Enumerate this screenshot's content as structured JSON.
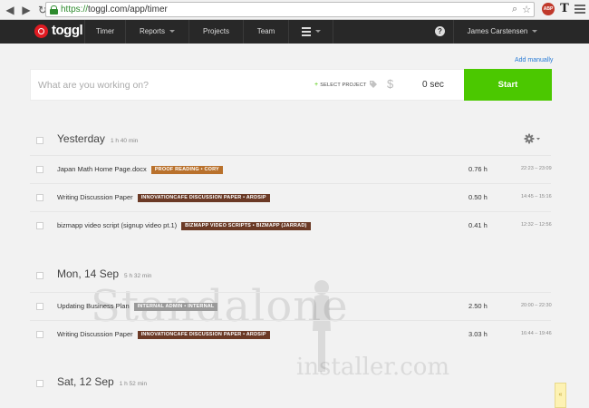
{
  "browser": {
    "url_scheme": "https://",
    "url_rest": "toggl.com/app/timer",
    "ext_abp": "ABP",
    "ext_t": "T"
  },
  "header": {
    "logo": "toggl",
    "nav": [
      "Timer",
      "Reports",
      "Projects",
      "Team"
    ],
    "help": "?",
    "user": "James Carstensen"
  },
  "timer": {
    "add_manually": "Add manually",
    "placeholder": "What are you working on?",
    "select_project": "SELECT PROJECT",
    "duration": "0 sec",
    "start_label": "Start"
  },
  "days": [
    {
      "title": "Yesterday",
      "total": "1 h 40 min",
      "entries": [
        {
          "description": "Japan Math Home Page.docx",
          "tag": "PROOF READING  •  CORY",
          "tag_color": "#b9712c",
          "duration": "0.76 h",
          "range": "22:23 – 23:09"
        },
        {
          "description": "Writing Discussion Paper",
          "tag": "INNOVATIONCAFE DISCUSSION PAPER  •  ARDSIP",
          "tag_color": "#6b3a26",
          "duration": "0.50 h",
          "range": "14:45 – 15:16"
        },
        {
          "description": "bizmapp video script (signup video pt.1)",
          "tag": "BIZMAPP VIDEO SCRIPTS  •  BIZMAPP (JARRAD)",
          "tag_color": "#6b3a26",
          "duration": "0.41 h",
          "range": "12:32 – 12:56"
        }
      ]
    },
    {
      "title": "Mon, 14 Sep",
      "total": "5 h 32 min",
      "entries": [
        {
          "description": "Updating Business Plan",
          "tag": "INTERNAL ADMIN  •  INTERNAL",
          "tag_color": "#9a9a9a",
          "duration": "2.50 h",
          "range": "20:00 – 22:30"
        },
        {
          "description": "Writing Discussion Paper",
          "tag": "INNOVATIONCAFE DISCUSSION PAPER  •  ARDSIP",
          "tag_color": "#6b3a26",
          "duration": "3.03 h",
          "range": "16:44 – 19:46"
        }
      ]
    },
    {
      "title": "Sat, 12 Sep",
      "total": "1 h 52 min",
      "entries": []
    }
  ],
  "watermark": {
    "line1": "Standalone",
    "line2": "installer.com"
  },
  "scroll_top": "«"
}
